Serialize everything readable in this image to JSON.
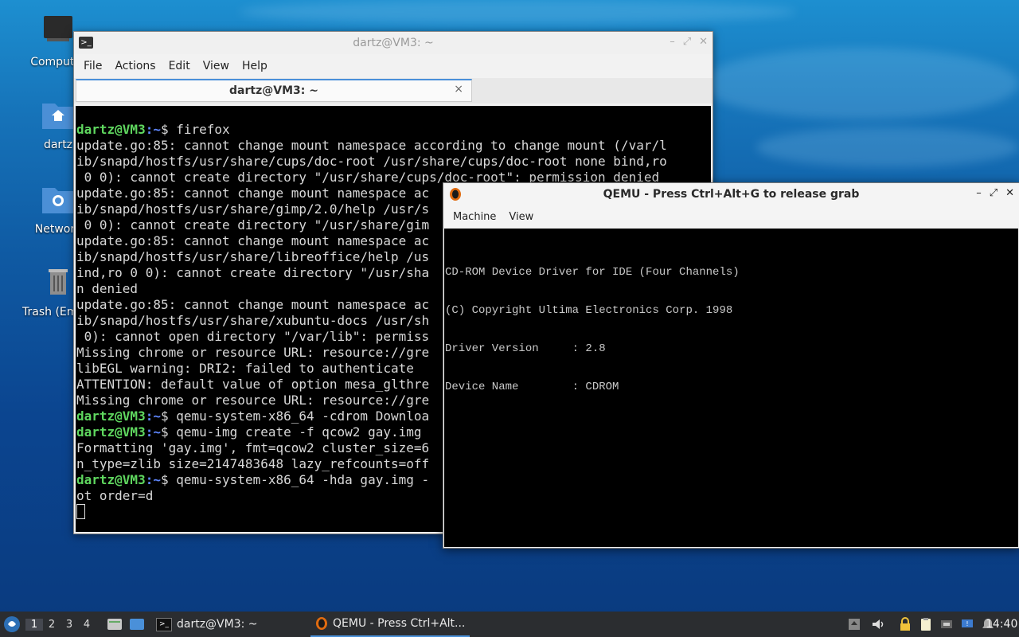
{
  "desktop": {
    "icons": [
      {
        "label": "Computer"
      },
      {
        "label": "dartz"
      },
      {
        "label": "Network"
      },
      {
        "label": "Trash (Empty)"
      }
    ]
  },
  "terminal": {
    "title": "dartz@VM3: ~",
    "menu": [
      "File",
      "Actions",
      "Edit",
      "View",
      "Help"
    ],
    "tab_label": "dartz@VM3: ~",
    "tab_close": "×",
    "prompt_user": "dartz@VM3",
    "prompt_path": ":~",
    "prompt_symbol": "$",
    "lines": [
      {
        "prompt": true,
        "cmd": " firefox"
      },
      {
        "text": "update.go:85: cannot change mount namespace according to change mount (/var/l"
      },
      {
        "text": "ib/snapd/hostfs/usr/share/cups/doc-root /usr/share/cups/doc-root none bind,ro"
      },
      {
        "text": " 0 0): cannot create directory \"/usr/share/cups/doc-root\": permission denied"
      },
      {
        "text": "update.go:85: cannot change mount namespace ac"
      },
      {
        "text": "ib/snapd/hostfs/usr/share/gimp/2.0/help /usr/s"
      },
      {
        "text": " 0 0): cannot create directory \"/usr/share/gim"
      },
      {
        "text": "update.go:85: cannot change mount namespace ac"
      },
      {
        "text": "ib/snapd/hostfs/usr/share/libreoffice/help /us"
      },
      {
        "text": "ind,ro 0 0): cannot create directory \"/usr/sha"
      },
      {
        "text": "n denied"
      },
      {
        "text": "update.go:85: cannot change mount namespace ac"
      },
      {
        "text": "ib/snapd/hostfs/usr/share/xubuntu-docs /usr/sh"
      },
      {
        "text": " 0): cannot open directory \"/var/lib\": permiss"
      },
      {
        "text": "Missing chrome or resource URL: resource://gre"
      },
      {
        "text": "libEGL warning: DRI2: failed to authenticate"
      },
      {
        "text": "ATTENTION: default value of option mesa_glthre"
      },
      {
        "text": "Missing chrome or resource URL: resource://gre"
      },
      {
        "prompt": true,
        "cmd": " qemu-system-x86_64 -cdrom Downloa"
      },
      {
        "prompt": true,
        "cmd": " qemu-img create -f qcow2 gay.img"
      },
      {
        "text": "Formatting 'gay.img', fmt=qcow2 cluster_size=6"
      },
      {
        "text": "n_type=zlib size=2147483648 lazy_refcounts=off"
      },
      {
        "prompt": true,
        "cmd": " qemu-system-x86_64 -hda gay.img -"
      },
      {
        "text": "ot order=d"
      }
    ]
  },
  "qemu": {
    "title": "QEMU - Press Ctrl+Alt+G to release grab",
    "menu": [
      "Machine",
      "View"
    ],
    "screen_lines": [
      "CD-ROM Device Driver for IDE (Four Channels)",
      "(C) Copyright Ultima Electronics Corp. 1998",
      "Driver Version     : 2.8",
      "Device Name        : CDROM"
    ]
  },
  "taskbar": {
    "workspaces": [
      "1",
      "2",
      "3",
      "4"
    ],
    "active_workspace": "1",
    "tasks": [
      {
        "label": "dartz@VM3: ~"
      },
      {
        "label": "QEMU - Press Ctrl+Alt..."
      }
    ],
    "clock": "14:40"
  },
  "colors": {
    "prompt_green": "#5fd75f",
    "prompt_blue": "#5f87ff",
    "accent": "#4a90d9"
  }
}
